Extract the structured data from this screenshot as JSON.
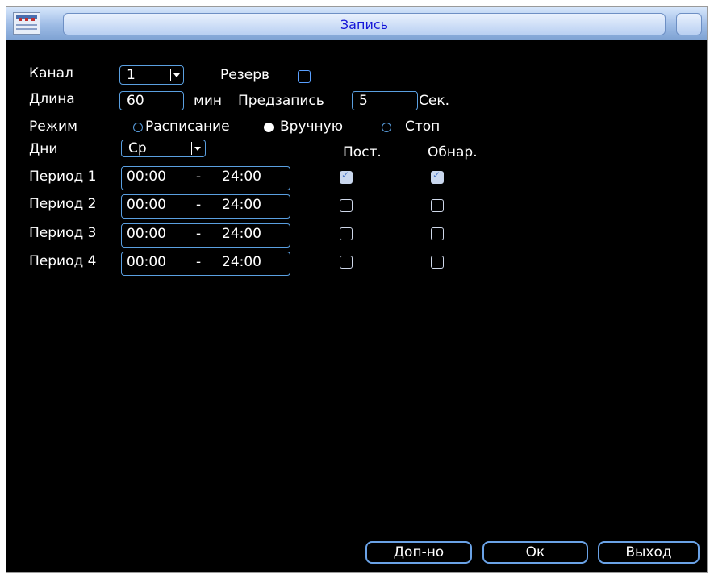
{
  "window": {
    "title": "Запись"
  },
  "form": {
    "channel_label": "Канал",
    "channel_value": "1",
    "reserve_label": "Резерв",
    "length_label": "Длина",
    "length_value": "60",
    "min_label": "мин",
    "prerecord_label": "Предзапись",
    "prerecord_value": "5",
    "sec_label": "Сек.",
    "mode_label": "Режим",
    "mode_options": [
      "Расписание",
      "Вручную",
      "Стоп"
    ],
    "mode_selected": "Вручную",
    "days_label": "Дни",
    "days_value": "Ср",
    "col_const": "Пост.",
    "col_detect": "Обнар."
  },
  "periods": [
    {
      "label": "Период 1",
      "start": "00:00",
      "end": "24:00",
      "const": true,
      "detect": true
    },
    {
      "label": "Период 2",
      "start": "00:00",
      "end": "24:00",
      "const": false,
      "detect": false
    },
    {
      "label": "Период 3",
      "start": "00:00",
      "end": "24:00",
      "const": false,
      "detect": false
    },
    {
      "label": "Период 4",
      "start": "00:00",
      "end": "24:00",
      "const": false,
      "detect": false
    }
  ],
  "buttons": {
    "advanced": "Доп-но",
    "ok": "Ок",
    "exit": "Выход"
  }
}
